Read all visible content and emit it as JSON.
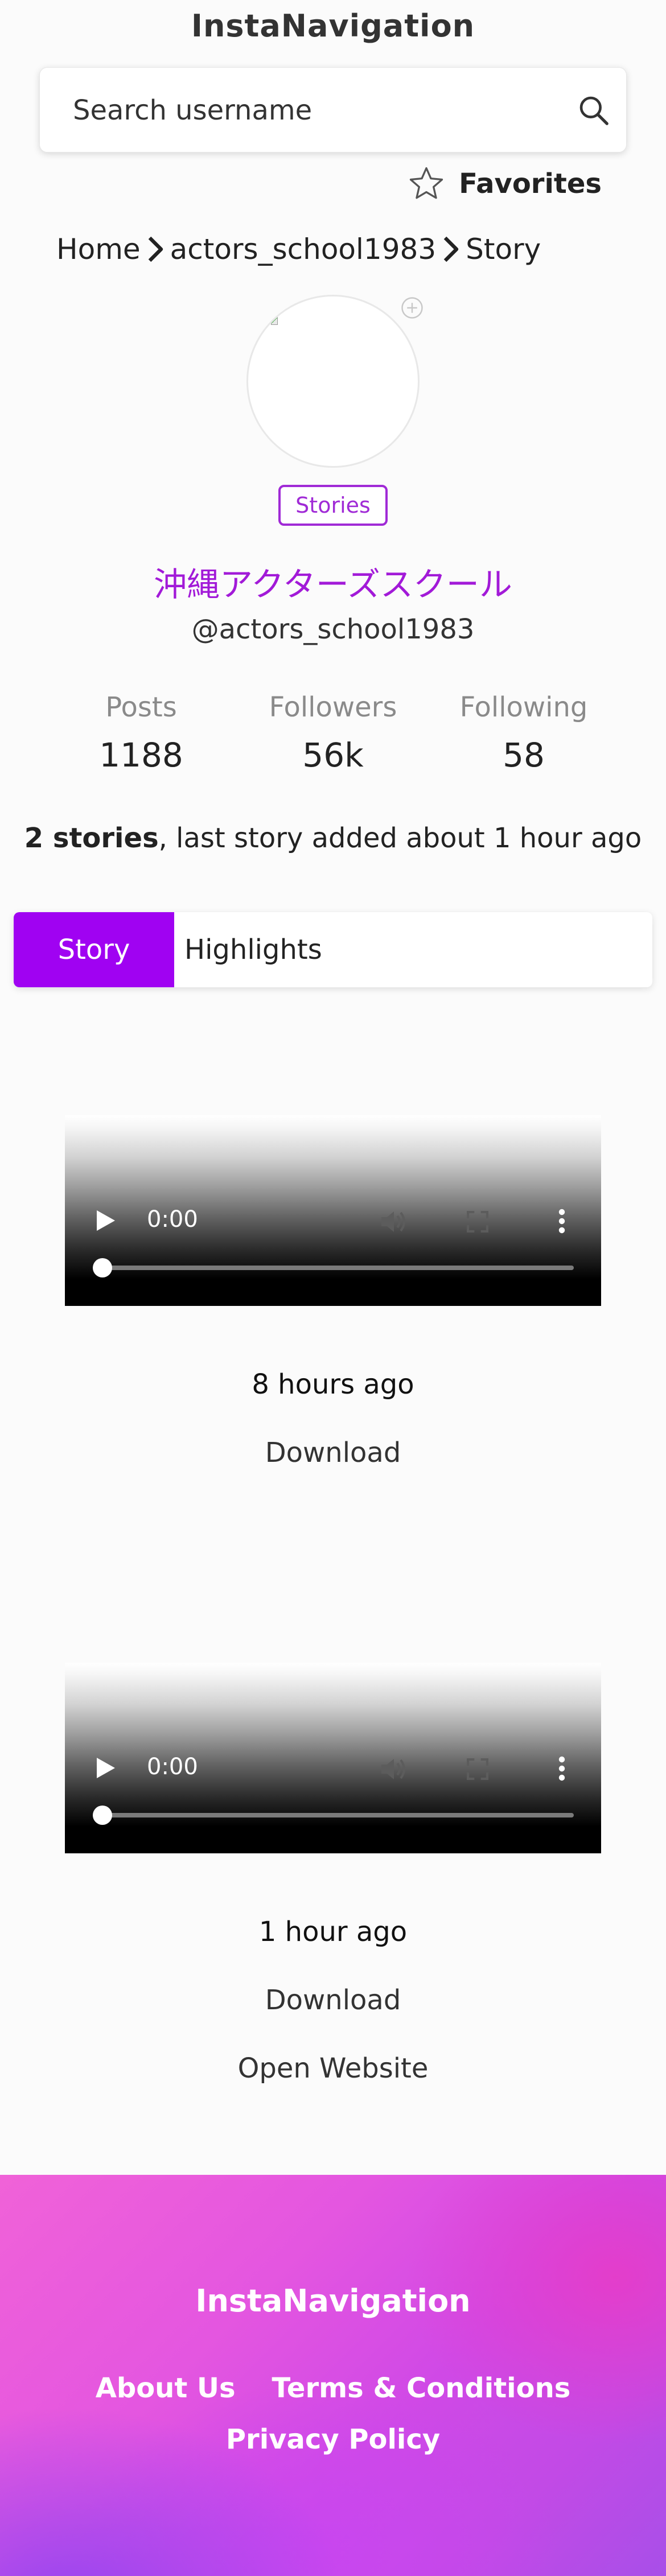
{
  "app": {
    "title": "InstaNavigation"
  },
  "search": {
    "placeholder": "Search username",
    "value": "",
    "icon": "search-icon"
  },
  "favorites": {
    "label": "Favorites",
    "icon": "star-icon"
  },
  "breadcrumb": {
    "items": [
      "Home",
      "actors_school1983",
      "Story"
    ]
  },
  "profile": {
    "avatar_alt": "",
    "stories_badge": "Stories",
    "display_name": "沖縄アクターズスクール",
    "username": "@actors_school1983",
    "stats": [
      {
        "label": "Posts",
        "value": "1188"
      },
      {
        "label": "Followers",
        "value": "56k"
      },
      {
        "label": "Following",
        "value": "58"
      }
    ]
  },
  "stories_summary": {
    "count_text": "2 stories",
    "rest_text": ", last story added about 1 hour ago"
  },
  "tabs": [
    {
      "label": "Story",
      "active": true
    },
    {
      "label": "Highlights",
      "active": false
    }
  ],
  "stories": [
    {
      "video_time": "0:00",
      "posted": "8 hours ago",
      "download_label": "Download"
    },
    {
      "video_time": "0:00",
      "posted": "1 hour ago",
      "download_label": "Download",
      "open_label": "Open Website"
    }
  ],
  "footer": {
    "title": "InstaNavigation",
    "links": [
      "About Us",
      "Terms & Conditions",
      "Privacy Policy"
    ]
  },
  "colors": {
    "accent": "#a002f2",
    "name": "#a21ad8",
    "badge": "#a02ad6"
  }
}
